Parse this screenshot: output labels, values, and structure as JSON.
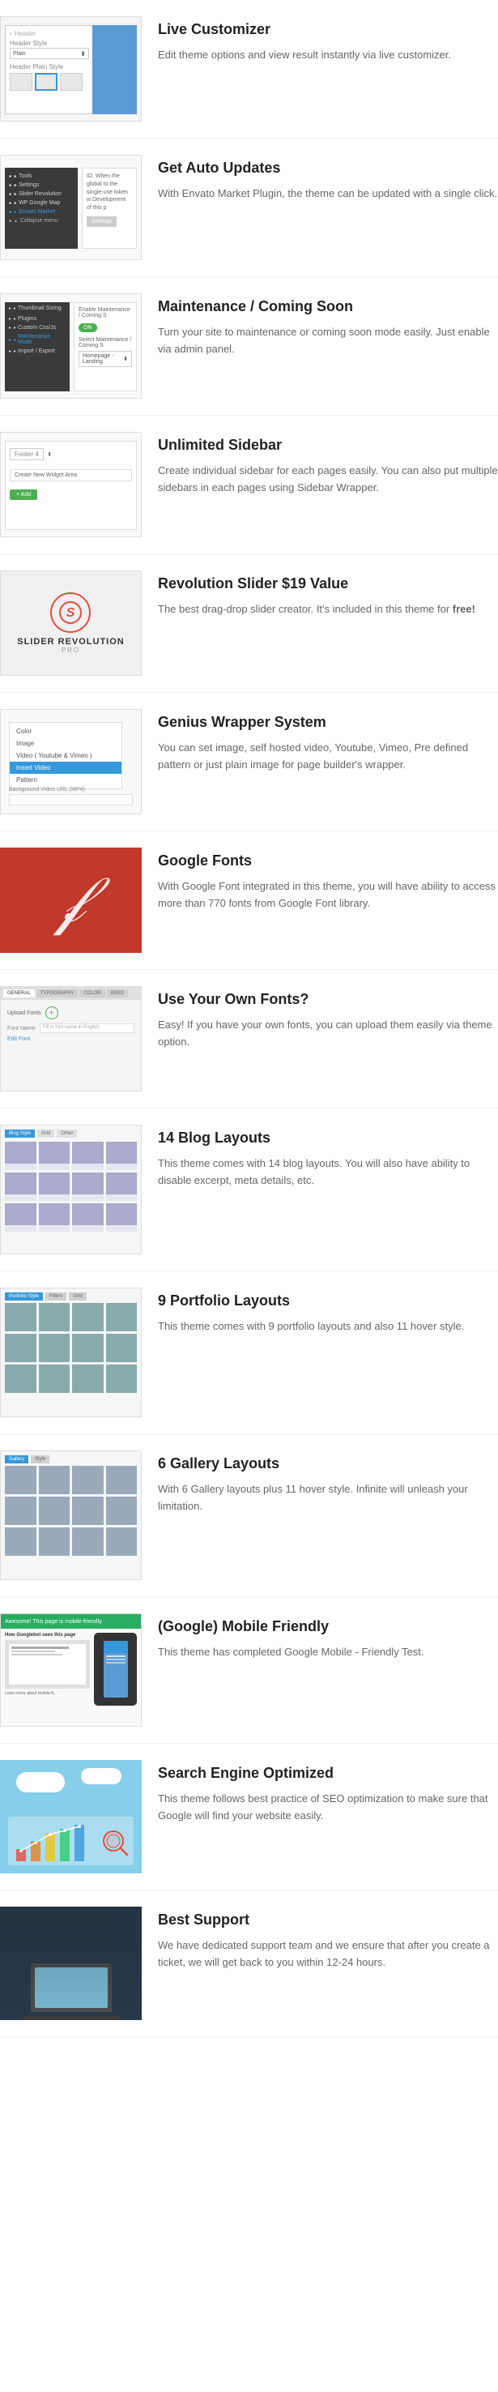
{
  "features": [
    {
      "id": "live-customizer",
      "title": "Live Customizer",
      "description": "Edit theme options and view result instantly via live customizer.",
      "image_type": "live-customizer",
      "panel": {
        "back_label": "Header",
        "field1_label": "Header Style",
        "field1_value": "Plain",
        "field2_label": "Header Plain Style"
      }
    },
    {
      "id": "auto-updates",
      "title": "Get Auto Updates",
      "description": "With Envato Market Plugin, the theme can be updated with a single click.",
      "image_type": "auto-updates",
      "menu_items": [
        "Tools",
        "Settings",
        "Slider Revolution",
        "WP Google Map",
        "Envato Market",
        "Collapse menu"
      ],
      "content_text": "ID. When the global to the single-use token w Development of this p",
      "button_label": "Settings"
    },
    {
      "id": "maintenance",
      "title": "Maintenance / Coming Soon",
      "description": "Turn your site to maintenance or coming soon mode easily. Just enable via admin panel.",
      "image_type": "maintenance",
      "side_items": [
        "Thumbnail Sizing",
        "Plugins",
        "Custom Css/Js",
        "Maintenance Mode",
        "Import / Export"
      ],
      "field1_label": "Enable Maintenance / Coming S",
      "toggle_label": "ON",
      "field2_label": "Select Maintenance / Coming S",
      "select_value": "Homepage - Landing"
    },
    {
      "id": "unlimited-sidebar",
      "title": "Unlimited Sidebar",
      "description": "Create individual sidebar for each pages easily. You can also put multiple sidebars in each pages using Sidebar Wrapper.",
      "image_type": "unlimited-sidebar",
      "footer_label": "Footer 4",
      "create_label": "Create New Widget Area",
      "add_label": "+ Add"
    },
    {
      "id": "slider-revolution",
      "title": "Revolution Slider $19 Value",
      "description": "The best drag-drop slider creator. It's included in this theme for free!",
      "image_type": "slider-revolution",
      "logo_text": "SLIDER REVOLUTION",
      "logo_sub": "PRO"
    },
    {
      "id": "genius-wrapper",
      "title": "Genius Wrapper System",
      "description": "You can set image, self hosted video, Youtube, Vimeo, Pre defined pattern or just plain image for page builder's wrapper.",
      "image_type": "genius-wrapper",
      "dropdown_items": [
        "Color",
        "Image",
        "Video ( Youtube & Vimeo )",
        "Insert Video",
        "Pattern"
      ],
      "active_item": "Insert Video",
      "url_label": "Background Video URL (MP4)"
    },
    {
      "id": "google-fonts",
      "title": "Google Fonts",
      "description": "With Google Font integrated in this theme, you will have ability to access more than 770 fonts from Google Font library.",
      "image_type": "google-fonts"
    },
    {
      "id": "own-fonts",
      "title": "Use Your Own Fonts?",
      "description": "Easy! If you have your own fonts, you can upload them easily via theme option.",
      "image_type": "own-fonts",
      "tabs": [
        "GENERAL",
        "TYPOGRAPHY",
        "COLOR",
        "WIDO"
      ],
      "upload_label": "Upload Fonts",
      "font_name_label": "Font Name",
      "font_name_placeholder": "Fill in font name in English",
      "edit_font_label": "Edit Font"
    },
    {
      "id": "blog-layouts",
      "title": "14 Blog Layouts",
      "description": "This theme comes with 14 blog layouts. You will also have ability to disable excerpt, meta details, etc.",
      "image_type": "blog-layouts",
      "tabs": [
        "Blog Style",
        "Grid",
        "Other"
      ]
    },
    {
      "id": "portfolio-layouts",
      "title": "9 Portfolio Layouts",
      "description": "This theme comes with 9 portfolio layouts and also 11 hover style.",
      "image_type": "portfolio-layouts",
      "tabs": [
        "Portfolio Style",
        "Filters",
        "Grid"
      ]
    },
    {
      "id": "gallery-layouts",
      "title": "6 Gallery Layouts",
      "description": "With 6 Gallery layouts plus 11 hover style. Infinite will unleash your limitation.",
      "image_type": "gallery-layouts",
      "tabs": [
        "Gallery",
        "Style"
      ]
    },
    {
      "id": "mobile-friendly",
      "title": "(Google) Mobile Friendly",
      "description": "This theme has completed Google Mobile - Friendly Test.",
      "image_type": "mobile-friendly",
      "green_bar_text": "Awesome! This page is mobile-friendly.",
      "col1_text": "How Googlebot sees this page",
      "col2_text": "Learn more about mobile-fr..."
    },
    {
      "id": "seo",
      "title": "Search Engine Optimized",
      "description": "This theme follows best practice of SEO optimization to make sure that Google will find your website easily.",
      "image_type": "seo"
    },
    {
      "id": "best-support",
      "title": "Best Support",
      "description": "We have dedicated support team and we ensure that after you create a ticket, we will get back to you within 12-24 hours.",
      "image_type": "best-support"
    }
  ]
}
